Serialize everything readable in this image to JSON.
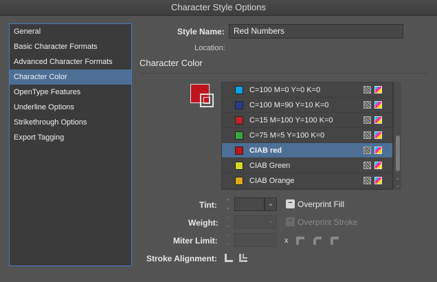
{
  "window": {
    "title": "Character Style Options"
  },
  "sidebar": {
    "items": [
      {
        "label": "General",
        "selected": false
      },
      {
        "label": "Basic Character Formats",
        "selected": false
      },
      {
        "label": "Advanced Character Formats",
        "selected": false
      },
      {
        "label": "Character Color",
        "selected": true
      },
      {
        "label": "OpenType Features",
        "selected": false
      },
      {
        "label": "Underline Options",
        "selected": false
      },
      {
        "label": "Strikethrough Options",
        "selected": false
      },
      {
        "label": "Export Tagging",
        "selected": false
      }
    ]
  },
  "form": {
    "style_name_label": "Style Name:",
    "style_name_value": "Red Numbers",
    "location_label": "Location:"
  },
  "section": {
    "title": "Character Color"
  },
  "preview": {
    "fill_color": "#c0141c"
  },
  "swatches": [
    {
      "name": "C=100 M=0 Y=0 K=0",
      "color": "#0aa3e8",
      "selected": false
    },
    {
      "name": "C=100 M=90 Y=10 K=0",
      "color": "#2a3a8c",
      "selected": false
    },
    {
      "name": "C=15 M=100 Y=100 K=0",
      "color": "#c2202a",
      "selected": false
    },
    {
      "name": "C=75 M=5 Y=100 K=0",
      "color": "#3aa640",
      "selected": false
    },
    {
      "name": "CIAB red",
      "color": "#c0141c",
      "selected": true
    },
    {
      "name": "CIAB Green",
      "color": "#d6d62a",
      "selected": false
    },
    {
      "name": "CIAB Orange",
      "color": "#e0a81c",
      "selected": false
    }
  ],
  "controls": {
    "tint_label": "Tint:",
    "tint_value": "",
    "overprint_fill_label": "Overprint Fill",
    "overprint_fill_checked": true,
    "weight_label": "Weight:",
    "weight_value": "",
    "overprint_stroke_label": "Overprint Stroke",
    "overprint_stroke_checked": true,
    "miter_label": "Miter Limit:",
    "miter_value": "",
    "miter_x": "x",
    "stroke_alignment_label": "Stroke Alignment:"
  },
  "icons": {
    "checkmark": "−",
    "chevron_down": "⌄",
    "stepper": "⌃⌄"
  }
}
